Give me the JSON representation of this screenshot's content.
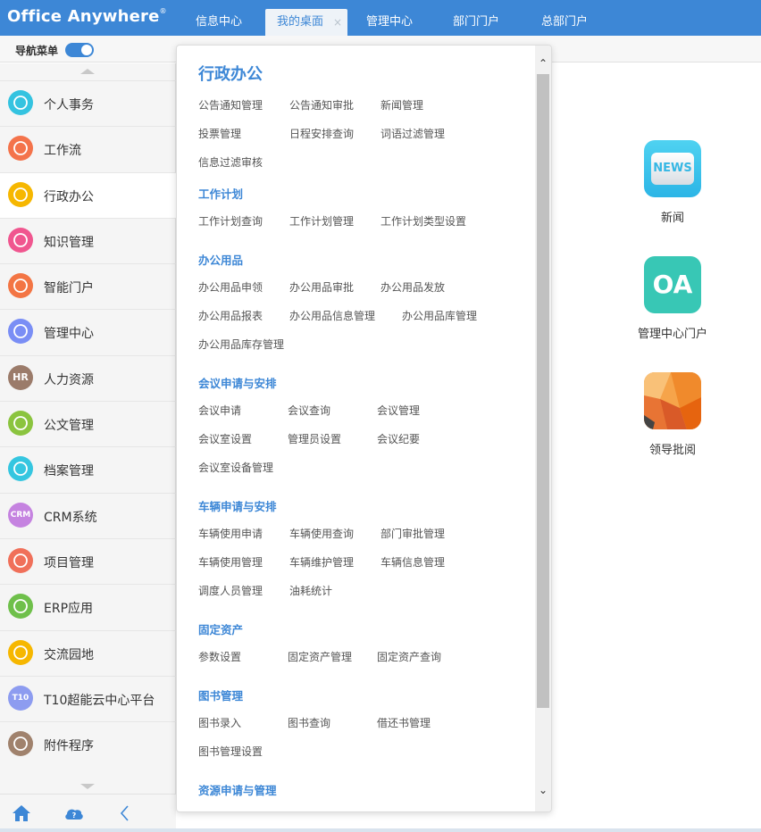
{
  "header": {
    "logo": "Office Anywhere",
    "logo_mark": "®",
    "tabs": [
      {
        "label": "信息中心"
      },
      {
        "label": "我的桌面",
        "close": "×"
      },
      {
        "label": "管理中心"
      },
      {
        "label": "部门门户"
      },
      {
        "label": "总部门户"
      }
    ],
    "accent": "#3d87d6"
  },
  "subbar": {
    "nav_label": "导航菜单"
  },
  "sidebar": {
    "items": [
      {
        "label": "个人事务",
        "icon": "user-icon",
        "color": "#34c3e0"
      },
      {
        "label": "工作流",
        "icon": "workflow-icon",
        "color": "#f4734b"
      },
      {
        "label": "行政办公",
        "icon": "layers-icon",
        "color": "#f6b700"
      },
      {
        "label": "知识管理",
        "icon": "book-icon",
        "color": "#f0568f"
      },
      {
        "label": "智能门户",
        "icon": "portal-icon",
        "color": "#f37544"
      },
      {
        "label": "管理中心",
        "icon": "phone-icon",
        "color": "#7a8ef5"
      },
      {
        "label": "人力资源",
        "icon": "hr-icon",
        "text": "HR",
        "color": "#9b7b6a"
      },
      {
        "label": "公文管理",
        "icon": "briefcase-icon",
        "color": "#8bc43f"
      },
      {
        "label": "档案管理",
        "icon": "archive-icon",
        "color": "#35c6e0"
      },
      {
        "label": "CRM系统",
        "icon": "crm-icon",
        "text": "CRM",
        "color": "#c583e0"
      },
      {
        "label": "项目管理",
        "icon": "project-icon",
        "color": "#f0705a"
      },
      {
        "label": "ERP应用",
        "icon": "chart-icon",
        "color": "#6fc04b"
      },
      {
        "label": "交流园地",
        "icon": "chat-icon",
        "color": "#f6b700"
      },
      {
        "label": "T10超能云中心平台",
        "icon": "cloud-icon",
        "text": "T10",
        "color": "#8d9cf0"
      },
      {
        "label": "附件程序",
        "icon": "paperclip-icon",
        "color": "#a0826d"
      }
    ],
    "active_index": 2
  },
  "apps": [
    {
      "label": "新闻",
      "tile_text": "NEWS"
    },
    {
      "label": "管理中心门户",
      "tile_text": "OA"
    },
    {
      "label": "领导批阅",
      "tile_text": ""
    }
  ],
  "menu": {
    "title": "行政办公",
    "top_links": [
      [
        "公告通知管理",
        "公告通知审批",
        "新闻管理"
      ],
      [
        "投票管理",
        "日程安排查询",
        "词语过滤管理"
      ],
      [
        "信息过滤审核"
      ]
    ],
    "sections": [
      {
        "title": "工作计划",
        "rows": [
          [
            "工作计划查询",
            "工作计划管理",
            "工作计划类型设置"
          ]
        ]
      },
      {
        "title": "办公用品",
        "rows": [
          [
            "办公用品申领",
            "办公用品审批",
            "办公用品发放"
          ],
          [
            "办公用品报表",
            "办公用品信息管理",
            "办公用品库管理"
          ],
          [
            "办公用品库存管理"
          ]
        ]
      },
      {
        "title": "会议申请与安排",
        "rows": [
          [
            "会议申请",
            "会议查询",
            "会议管理"
          ],
          [
            "会议室设置",
            "管理员设置",
            "会议纪要"
          ],
          [
            "会议室设备管理"
          ]
        ]
      },
      {
        "title": "车辆申请与安排",
        "rows": [
          [
            "车辆使用申请",
            "车辆使用查询",
            "部门审批管理"
          ],
          [
            "车辆使用管理",
            "车辆维护管理",
            "车辆信息管理"
          ],
          [
            "调度人员管理",
            "油耗统计"
          ]
        ]
      },
      {
        "title": "固定资产",
        "rows": [
          [
            "参数设置",
            "固定资产管理",
            "固定资产查询"
          ]
        ]
      },
      {
        "title": "图书管理",
        "rows": [
          [
            "图书录入",
            "图书查询",
            "借还书管理"
          ],
          [
            "图书管理设置"
          ]
        ]
      },
      {
        "title": "资源申请与管理",
        "rows": []
      }
    ]
  }
}
